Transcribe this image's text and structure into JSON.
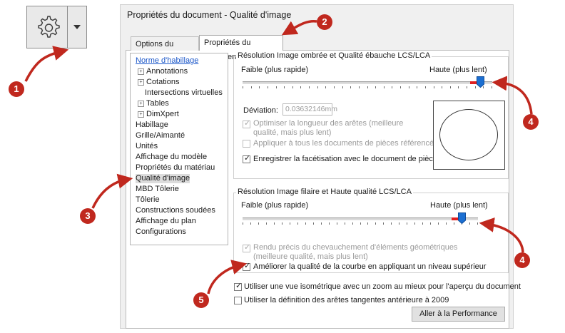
{
  "dialog": {
    "title": "Propriétés du document - Qualité d'image",
    "tabs": [
      {
        "label": "Options du système"
      },
      {
        "label": "Propriétés du document"
      }
    ]
  },
  "tree": {
    "items": [
      {
        "label": "Norme d'habillage"
      },
      {
        "label": "Annotations"
      },
      {
        "label": "Cotations"
      },
      {
        "label": "Intersections virtuelles"
      },
      {
        "label": "Tables"
      },
      {
        "label": "DimXpert"
      },
      {
        "label": "Habillage"
      },
      {
        "label": "Grille/Aimanté"
      },
      {
        "label": "Unités"
      },
      {
        "label": "Affichage du modèle"
      },
      {
        "label": "Propriétés du matériau"
      },
      {
        "label": "Qualité d'image"
      },
      {
        "label": "MBD Tôlerie"
      },
      {
        "label": "Tôlerie"
      },
      {
        "label": "Constructions soudées"
      },
      {
        "label": "Affichage du plan"
      },
      {
        "label": "Configurations"
      }
    ]
  },
  "shaded": {
    "title": "Résolution Image ombrée et Qualité ébauche LCS/LCA",
    "low_label": "Faible (plus rapide)",
    "high_label": "Haute (plus lent)",
    "slider_value": 0.95,
    "deviation_label": "Déviation:",
    "deviation_value": "0.03632146mm",
    "optimize_label": "Optimiser la longueur des arêtes (meilleure qualité, mais plus lent)",
    "apply_label": "Appliquer à tous les documents de pièces référencés",
    "save_label": "Enregistrer la facétisation avec le document de pièce"
  },
  "wireframe": {
    "title": "Résolution Image filaire et Haute qualité LCS/LCA",
    "low_label": "Faible (plus rapide)",
    "high_label": "Haute (plus lent)",
    "slider_value": 0.93,
    "precise_label": "Rendu précis du chevauchement d'éléments géométriques (meilleure qualité, mais plus lent)",
    "improve_label": "Améliorer la qualité de la courbe en appliquant un niveau supérieur"
  },
  "options": {
    "iso_label": "Utiliser une vue isométrique avec un zoom au mieux pour l'aperçu du document",
    "tangent_label": "Utiliser la définition des arêtes tangentes antérieure à 2009",
    "perf_button": "Aller à la Performance"
  },
  "callouts": [
    "1",
    "2",
    "3",
    "4",
    "4",
    "5"
  ],
  "colors": {
    "callout": "#c0281e",
    "slider_fill": "#e02020",
    "thumb": "#1c6fd1"
  }
}
